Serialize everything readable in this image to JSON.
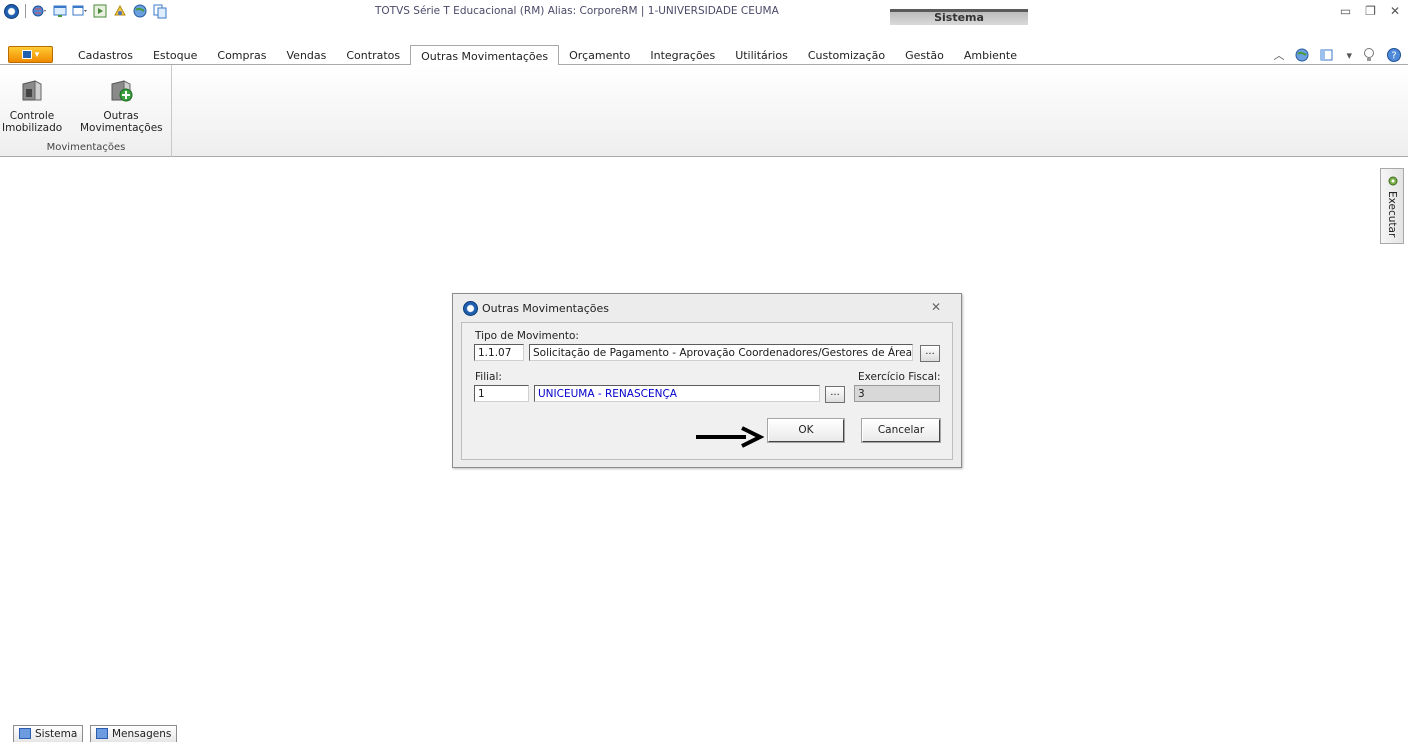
{
  "window": {
    "title": "TOTVS Série T Educacional (RM) Alias: CorporeRM | 1-UNIVERSIDADE CEUMA",
    "context_group": "Sistema",
    "controls": [
      "minimize",
      "restore",
      "close"
    ]
  },
  "quick_access": [
    "app-orb-icon",
    "globe-dropdown-icon",
    "window-icon",
    "window-dropdown-icon",
    "grid-icon",
    "palette-icon",
    "globe-icon",
    "copy-icon"
  ],
  "tabs": [
    {
      "label": "Cadastros",
      "active": false
    },
    {
      "label": "Estoque",
      "active": false
    },
    {
      "label": "Compras",
      "active": false
    },
    {
      "label": "Vendas",
      "active": false
    },
    {
      "label": "Contratos",
      "active": false
    },
    {
      "label": "Outras Movimentações",
      "active": true
    },
    {
      "label": "Orçamento",
      "active": false
    },
    {
      "label": "Integrações",
      "active": false
    },
    {
      "label": "Utilitários",
      "active": false
    },
    {
      "label": "Customização",
      "active": false
    },
    {
      "label": "Gestão",
      "active": false
    },
    {
      "label": "Ambiente",
      "active": false
    }
  ],
  "ribbon": {
    "group_label": "Movimentações",
    "buttons": [
      {
        "line1": "Controle",
        "line2": "Imobilizado"
      },
      {
        "line1": "Outras",
        "line2": "Movimentações"
      }
    ]
  },
  "side_panel": {
    "label": "Executar"
  },
  "dialog": {
    "title": "Outras Movimentações",
    "close": "✕",
    "tipo_label": "Tipo de Movimento:",
    "tipo_code": "1.1.07",
    "tipo_desc": "Solicitação de Pagamento - Aprovação Coordenadores/Gestores de Áreas",
    "filial_label": "Filial:",
    "filial_code": "1",
    "filial_desc": "UNICEUMA - RENASCENÇA",
    "exercicio_label": "Exercício Fiscal:",
    "exercicio_value": "3",
    "lookup_label": "...",
    "ok_label": "OK",
    "cancel_label": "Cancelar"
  },
  "statusbar": {
    "buttons": [
      "Sistema",
      "Mensagens"
    ]
  },
  "colors": {
    "accent_orange": "#f08a00",
    "brand_blue": "#1f5fae",
    "link_blue": "#0000cc"
  }
}
